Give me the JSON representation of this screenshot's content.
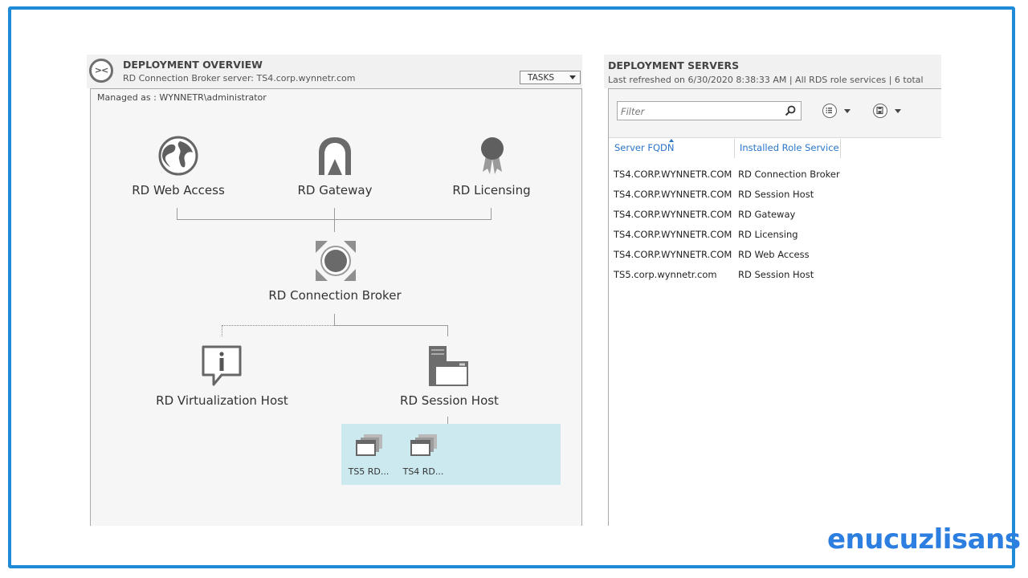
{
  "overview": {
    "title": "DEPLOYMENT OVERVIEW",
    "subtitle": "RD Connection Broker server: TS4.corp.wynnetr.com",
    "tasks_label": "TASKS",
    "managed_as": "Managed as : WYNNETR\\administrator",
    "roles": {
      "web_access": "RD Web Access",
      "gateway": "RD Gateway",
      "licensing": "RD Licensing",
      "connection_broker": "RD Connection Broker",
      "virtualization_host": "RD Virtualization Host",
      "session_host": "RD Session Host"
    },
    "session_hosts": [
      "TS5 RD...",
      "TS4 RD..."
    ]
  },
  "servers": {
    "title": "DEPLOYMENT SERVERS",
    "subtitle": "Last refreshed on 6/30/2020 8:38:33 AM | All RDS role services  | 6 total",
    "filter_placeholder": "Filter",
    "columns": {
      "fqdn": "Server FQDN",
      "role": "Installed Role Service"
    },
    "rows": [
      {
        "fqdn": "TS4.CORP.WYNNETR.COM",
        "role": "RD Connection Broker"
      },
      {
        "fqdn": "TS4.CORP.WYNNETR.COM",
        "role": "RD Session Host"
      },
      {
        "fqdn": "TS4.CORP.WYNNETR.COM",
        "role": "RD Gateway"
      },
      {
        "fqdn": "TS4.CORP.WYNNETR.COM",
        "role": "RD Licensing"
      },
      {
        "fqdn": "TS4.CORP.WYNNETR.COM",
        "role": "RD Web Access"
      },
      {
        "fqdn": "TS5.corp.wynnetr.com",
        "role": "RD Session Host"
      }
    ]
  },
  "brand": {
    "text": "enucuzlisans"
  },
  "colors": {
    "frame": "#1f8ad8",
    "link_blue": "#2a75c9",
    "session_hosts_highlight": "#cce9ef",
    "brand": "#2c7ee0"
  },
  "icons": {
    "overview": "remote-desktop-icon",
    "web_access": "globe-icon",
    "gateway": "gateway-icon",
    "licensing": "ribbon-award-icon",
    "connection_broker": "broker-icon",
    "virtualization_host": "info-bubble-icon",
    "session_host": "server-window-icon",
    "session_host_item": "windows-stack-icon",
    "search": "search-icon",
    "list_view": "list-icon",
    "save_query": "save-icon"
  }
}
